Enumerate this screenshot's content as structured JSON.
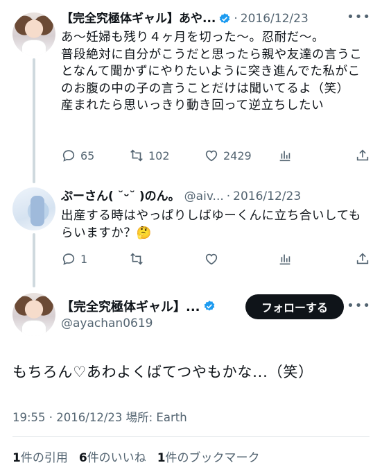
{
  "tweet1": {
    "name": "【完全究極体ギャル】あや...",
    "date": "2016/12/23",
    "text": "あ〜妊婦も残り４ヶ月を切った〜。忍耐だ〜。\n普段絶対に自分がこうだと思ったら親や友達の言うことなんて聞かずにやりたいように突き進んでた私がこのお腹の中の子の言うことだけは聞いてるよ（笑）\n産まれたら思いっきり動き回って逆立ちしたい",
    "replies": "65",
    "retweets": "102",
    "likes": "2429"
  },
  "tweet2": {
    "name": "ぷーさん(  ˘ᵕ˘  )のん。",
    "handle": "@aiv...",
    "date": "2016/12/23",
    "text": "出産する時はやっぱりしばゆーくんに立ち合いしてもらいますか？🤔",
    "replies": "1"
  },
  "focus": {
    "name": "【完全究極体ギャル】...",
    "handle": "@ayachan0619",
    "follow_label": "フォローする",
    "text": "もちろん♡あわよくばてつやもかな...（笑）",
    "time": "19:55 · 2016/12/23 場所: Earth",
    "quotes_count": "1",
    "quotes_label": "件の引用",
    "likes_count": "6",
    "likes_label": "件のいいね",
    "bookmarks_count": "1",
    "bookmarks_label": "件のブックマーク"
  },
  "common": {
    "dot": "·",
    "more": "•••"
  },
  "icons": {
    "reply": "reply-icon",
    "retweet": "retweet-icon",
    "like": "heart-icon",
    "views": "views-icon",
    "share": "share-icon",
    "verified": "verified-badge-icon"
  },
  "colors": {
    "verified": "#1d9bf0",
    "secondary_text": "#536471",
    "thread_line": "#cfd9de",
    "follow_button": "#0f1419"
  }
}
